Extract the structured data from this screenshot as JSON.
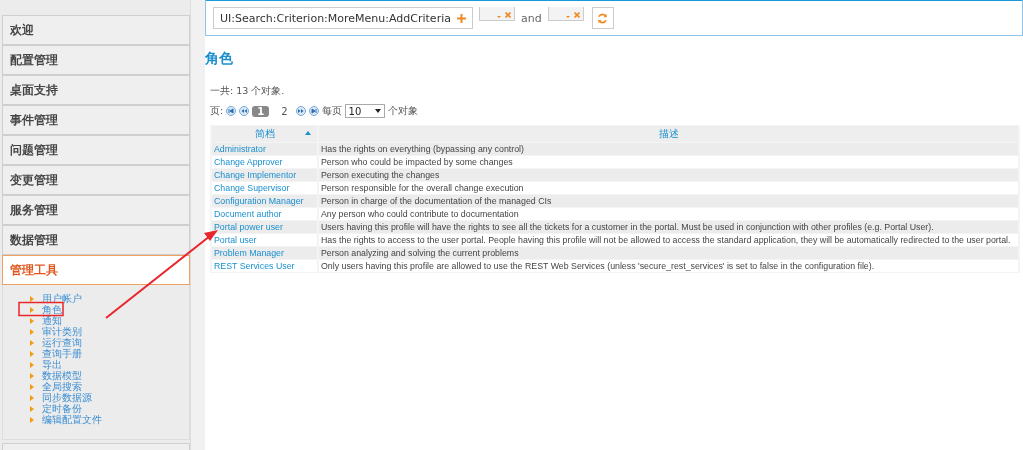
{
  "sidebar": {
    "items": [
      {
        "label": "欢迎",
        "expanded": false
      },
      {
        "label": "配置管理",
        "expanded": false
      },
      {
        "label": "桌面支持",
        "expanded": false
      },
      {
        "label": "事件管理",
        "expanded": false
      },
      {
        "label": "问题管理",
        "expanded": false
      },
      {
        "label": "变更管理",
        "expanded": false
      },
      {
        "label": "服务管理",
        "expanded": false
      },
      {
        "label": "数据管理",
        "expanded": false
      },
      {
        "label": "管理工具",
        "expanded": true,
        "children": [
          "用户帐户",
          "角色",
          "通知",
          "审计类别",
          "运行查询",
          "查询手册",
          "导出",
          "数据模型",
          "全局搜索",
          "同步数据源",
          "定时备份",
          "编辑配置文件"
        ]
      }
    ]
  },
  "search": {
    "criterion": "UI:Search:Criterion:MoreMenu:AddCriteria",
    "joiner": "and"
  },
  "title": "角色",
  "total": "一共: 13 个对象.",
  "pager": {
    "label": "页:",
    "pages": [
      {
        "label": "1",
        "selected": true
      },
      {
        "label": "2",
        "selected": false
      }
    ],
    "per_page_label": "每页",
    "per_page": "10",
    "unit": "个对象"
  },
  "table": {
    "columns": [
      {
        "label": "简档",
        "sorted": true
      },
      {
        "label": "描述",
        "sorted": false
      }
    ],
    "rows": [
      [
        "Administrator",
        "Has the rights on everything (bypassing any control)"
      ],
      [
        "Change Approver",
        "Person who could be impacted by some changes"
      ],
      [
        "Change Implementor",
        "Person executing the changes"
      ],
      [
        "Change Supervisor",
        "Person responsible for the overall change execution"
      ],
      [
        "Configuration Manager",
        "Person in charge of the documentation of the managed CIs"
      ],
      [
        "Document author",
        "Any person who could contribute to documentation"
      ],
      [
        "Portal power user",
        "Users having this profile will have the rights to see all the tickets for a customer in the portal. Must be used in conjunction with other profiles (e.g. Portal User)."
      ],
      [
        "Portal user",
        "Has the rights to access to the user portal. People having this profile will not be allowed to access the standard application, they will be automatically redirected to the user portal."
      ],
      [
        "Problem Manager",
        "Person analyzing and solving the current problems"
      ],
      [
        "REST Services User",
        "Only users having this profile are allowed to use the REST Web Services (unless 'secure_rest_services' is set to false in the configuration file)."
      ]
    ]
  }
}
